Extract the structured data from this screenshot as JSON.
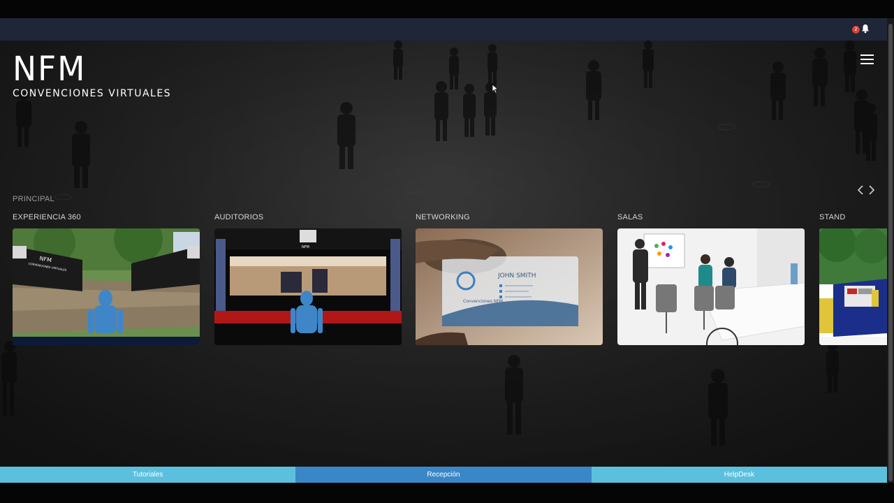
{
  "notification": {
    "count": "2",
    "icon": "bell-icon"
  },
  "logo": {
    "main": "NFM",
    "sub": "CONVENCIONES VIRTUALES"
  },
  "menu_icon": "hamburger-icon",
  "section": {
    "label": "PRINCIPAL"
  },
  "carousel": {
    "prev_icon": "chevron-left-icon",
    "next_icon": "chevron-right-icon",
    "cards": [
      {
        "title": "EXPERIENCIA 360"
      },
      {
        "title": "AUDITORIOS"
      },
      {
        "title": "NETWORKING",
        "card_text": {
          "name": "JOHN SMITH",
          "company": "Convenciones NFM"
        }
      },
      {
        "title": "SALAS"
      },
      {
        "title": "STAND"
      }
    ],
    "thumb_text": {
      "brand": "NFM",
      "brand_sub": "CONVENCIONES VIRTUALES"
    }
  },
  "bottom_nav": [
    {
      "label": "Tutoriales"
    },
    {
      "label": "Recepción"
    },
    {
      "label": "HelpDesk"
    }
  ],
  "colors": {
    "navbar": "#1e2637",
    "button_light": "#5bc0de",
    "button_dark": "#3a87c8",
    "badge": "#d9413a"
  }
}
